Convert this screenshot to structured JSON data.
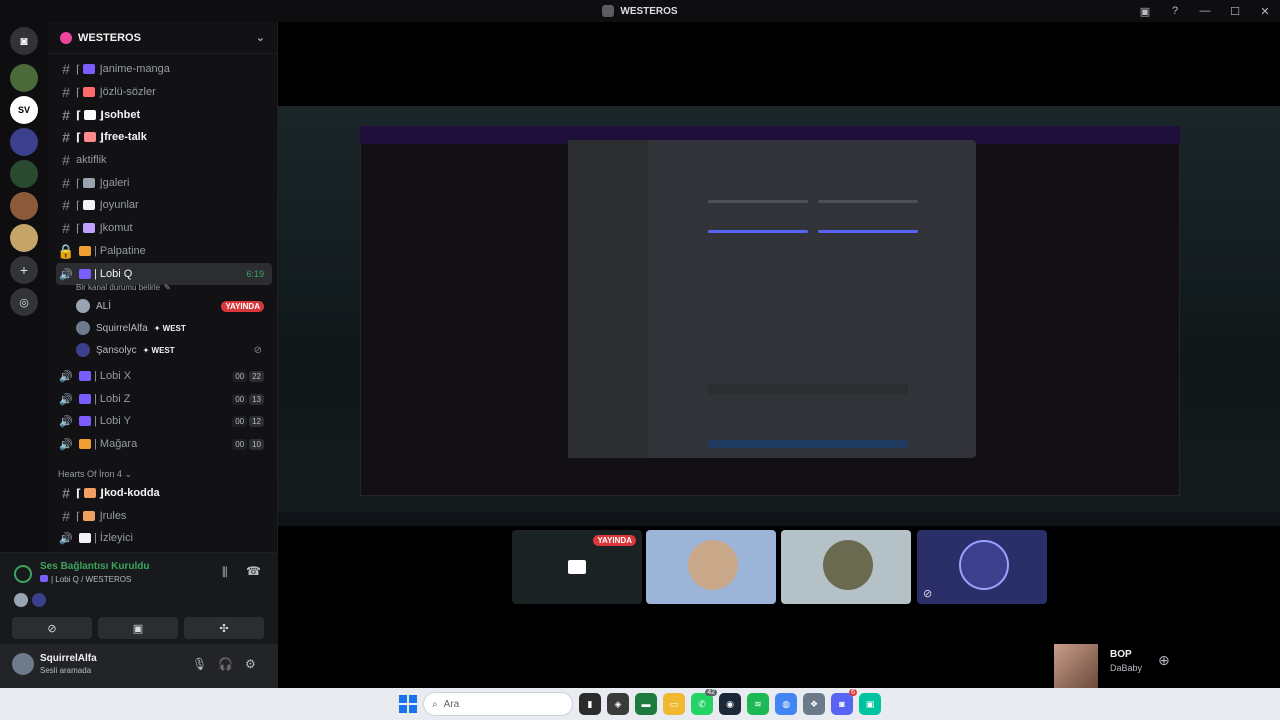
{
  "window": {
    "title": "WESTEROS",
    "minimize": "—",
    "maximize": "☐",
    "close": "✕",
    "help": "?"
  },
  "server": {
    "name": "WESTEROS"
  },
  "servers": [
    {
      "label": "D",
      "color": "#5865f2"
    },
    {
      "label": "",
      "color": "#4a6a3a"
    },
    {
      "label": "SV",
      "color": "#ffffff"
    },
    {
      "label": "",
      "color": "#3b3f8c"
    },
    {
      "label": "",
      "color": "#2a4a30"
    },
    {
      "label": "",
      "color": "#8a5a3a"
    },
    {
      "label": "",
      "color": "#c5a46a"
    }
  ],
  "channels": [
    {
      "type": "text",
      "name": "anime-manga",
      "bold": false,
      "emoji_color": "#7b5cff"
    },
    {
      "type": "text",
      "name": "özlü-sözler",
      "bold": false,
      "emoji_color": "#ff6b6b"
    },
    {
      "type": "text",
      "name": "sohbet",
      "bold": true,
      "emoji_color": "#ffffff"
    },
    {
      "type": "text",
      "name": "free-talk",
      "bold": true,
      "emoji_color": "#ff8a8a"
    },
    {
      "type": "text",
      "name": "aktiflik",
      "bold": false,
      "emoji_color": ""
    },
    {
      "type": "text",
      "name": "galeri",
      "bold": false,
      "emoji_color": "#9aa4b0"
    },
    {
      "type": "text",
      "name": "oyunlar",
      "bold": false,
      "emoji_color": "#f2f3f5"
    },
    {
      "type": "text",
      "name": "komut",
      "bold": false,
      "emoji_color": "#c0a0ff"
    },
    {
      "type": "locked",
      "name": "| Palpatine",
      "bold": false,
      "emoji_color": "#f0a030"
    }
  ],
  "active_voice": {
    "name": "| Lobi Q",
    "time": "6:19",
    "status": "Bir kanal durumu belirle"
  },
  "voice_users": [
    {
      "name": "ALİ",
      "tag": "",
      "live": "YAYINDA"
    },
    {
      "name": "SquirrelAlfa",
      "tag": "WEST",
      "live": ""
    },
    {
      "name": "Şansolyc",
      "tag": "WEST",
      "live": ""
    }
  ],
  "voice_channels": [
    {
      "name": "| Lobi X",
      "a": "00",
      "b": "22"
    },
    {
      "name": "| Lobi Z",
      "a": "00",
      "b": "13"
    },
    {
      "name": "| Lobi Y",
      "a": "00",
      "b": "12"
    },
    {
      "name": "| Mağara",
      "a": "00",
      "b": "10"
    }
  ],
  "category": "Hearts Of İron 4",
  "category_channels": [
    {
      "name": "kod-kodda",
      "bold": true
    },
    {
      "name": "rules",
      "bold": false
    },
    {
      "name": "| İzleyici",
      "bold": false
    }
  ],
  "voice_panel": {
    "status": "Ses Bağlantısı Kuruldu",
    "location": "| Lobi Q / WESTEROS"
  },
  "user_panel": {
    "name": "SquirrelAlfa",
    "status": "Sesli aramada"
  },
  "stream": {
    "live": "YAYINDA"
  },
  "spotify": {
    "title": "BOP",
    "artist": "DaBaby"
  },
  "taskbar": {
    "search_placeholder": "Ara",
    "whatsapp_badge": "42",
    "discord_badge": "6"
  }
}
